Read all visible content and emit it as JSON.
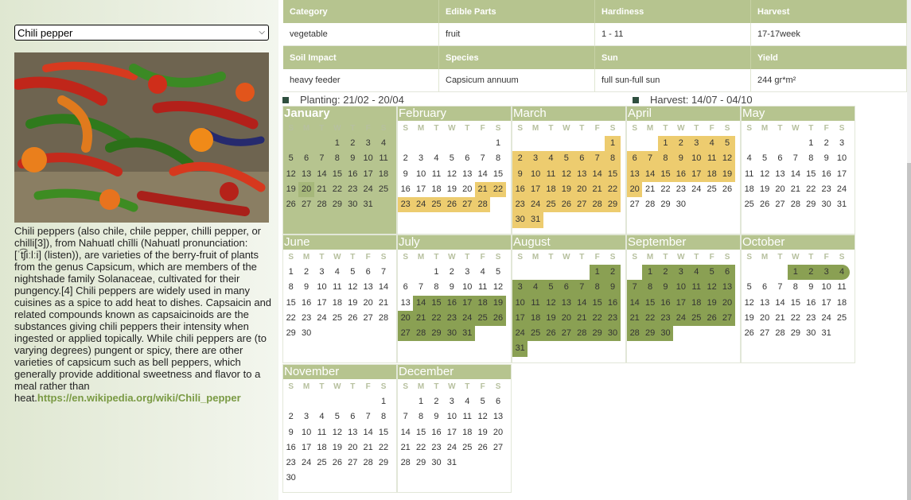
{
  "selector": {
    "selected": "Chili pepper"
  },
  "photo": {
    "icon": "chili-peppers-photo"
  },
  "description": {
    "text": "Chili peppers (also chile, chile pepper, chilli pepper, or chilli[3]), from Nahuatl chīlli (Nahuatl pronunciation: [ˈt͡ʃiːlːi] (listen)), are varieties of the berry-fruit of plants from the genus Capsicum, which are members of the nightshade family Solanaceae, cultivated for their pungency.[4] Chili peppers are widely used in many cuisines as a spice to add heat to dishes. Capsaicin and related compounds known as capsaicinoids are the substances giving chili peppers their intensity when ingested or applied topically. While chili peppers are (to varying degrees) pungent or spicy, there are other varieties of capsicum such as bell peppers, which generally provide additional sweetness and flavor to a meal rather than heat.",
    "link": "https://en.wikipedia.org/wiki/Chili_pepper"
  },
  "info": {
    "headers1": [
      "Category",
      "Edible Parts",
      "Hardiness",
      "Harvest"
    ],
    "values1": [
      "vegetable",
      "fruit",
      "1 - 11",
      "17-17week"
    ],
    "headers2": [
      "Soil Impact",
      "Species",
      "Sun",
      "Yield"
    ],
    "values2": [
      "heavy feeder",
      "Capsicum annuum",
      "full sun-full sun",
      "244 gr*m²"
    ]
  },
  "legend": {
    "planting": "Planting: 21/02 - 20/04",
    "harvest": "Harvest: 14/07 - 04/10"
  },
  "colors": {
    "planting": "#edcc6f",
    "harvest": "#8aa053",
    "header": "#b6c48f",
    "today": "#a6b87a"
  },
  "weekdays": [
    "S",
    "M",
    "T",
    "W",
    "T",
    "F",
    "S"
  ],
  "months": [
    {
      "name": "January",
      "offset": 3,
      "days": 31
    },
    {
      "name": "February",
      "offset": 6,
      "days": 28
    },
    {
      "name": "March",
      "offset": 6,
      "days": 31
    },
    {
      "name": "April",
      "offset": 2,
      "days": 30
    },
    {
      "name": "May",
      "offset": 4,
      "days": 31
    },
    {
      "name": "June",
      "offset": 0,
      "days": 30
    },
    {
      "name": "July",
      "offset": 2,
      "days": 31
    },
    {
      "name": "August",
      "offset": 5,
      "days": 31
    },
    {
      "name": "September",
      "offset": 1,
      "days": 30
    },
    {
      "name": "October",
      "offset": 3,
      "days": 31
    },
    {
      "name": "November",
      "offset": 6,
      "days": 30
    },
    {
      "name": "December",
      "offset": 1,
      "days": 31
    }
  ],
  "current_month": 1,
  "today": {
    "month": 1,
    "day": 20
  },
  "planting_range": {
    "start": [
      2,
      21
    ],
    "end": [
      4,
      20
    ]
  },
  "harvest_range": {
    "start": [
      7,
      14
    ],
    "end": [
      10,
      4
    ]
  }
}
